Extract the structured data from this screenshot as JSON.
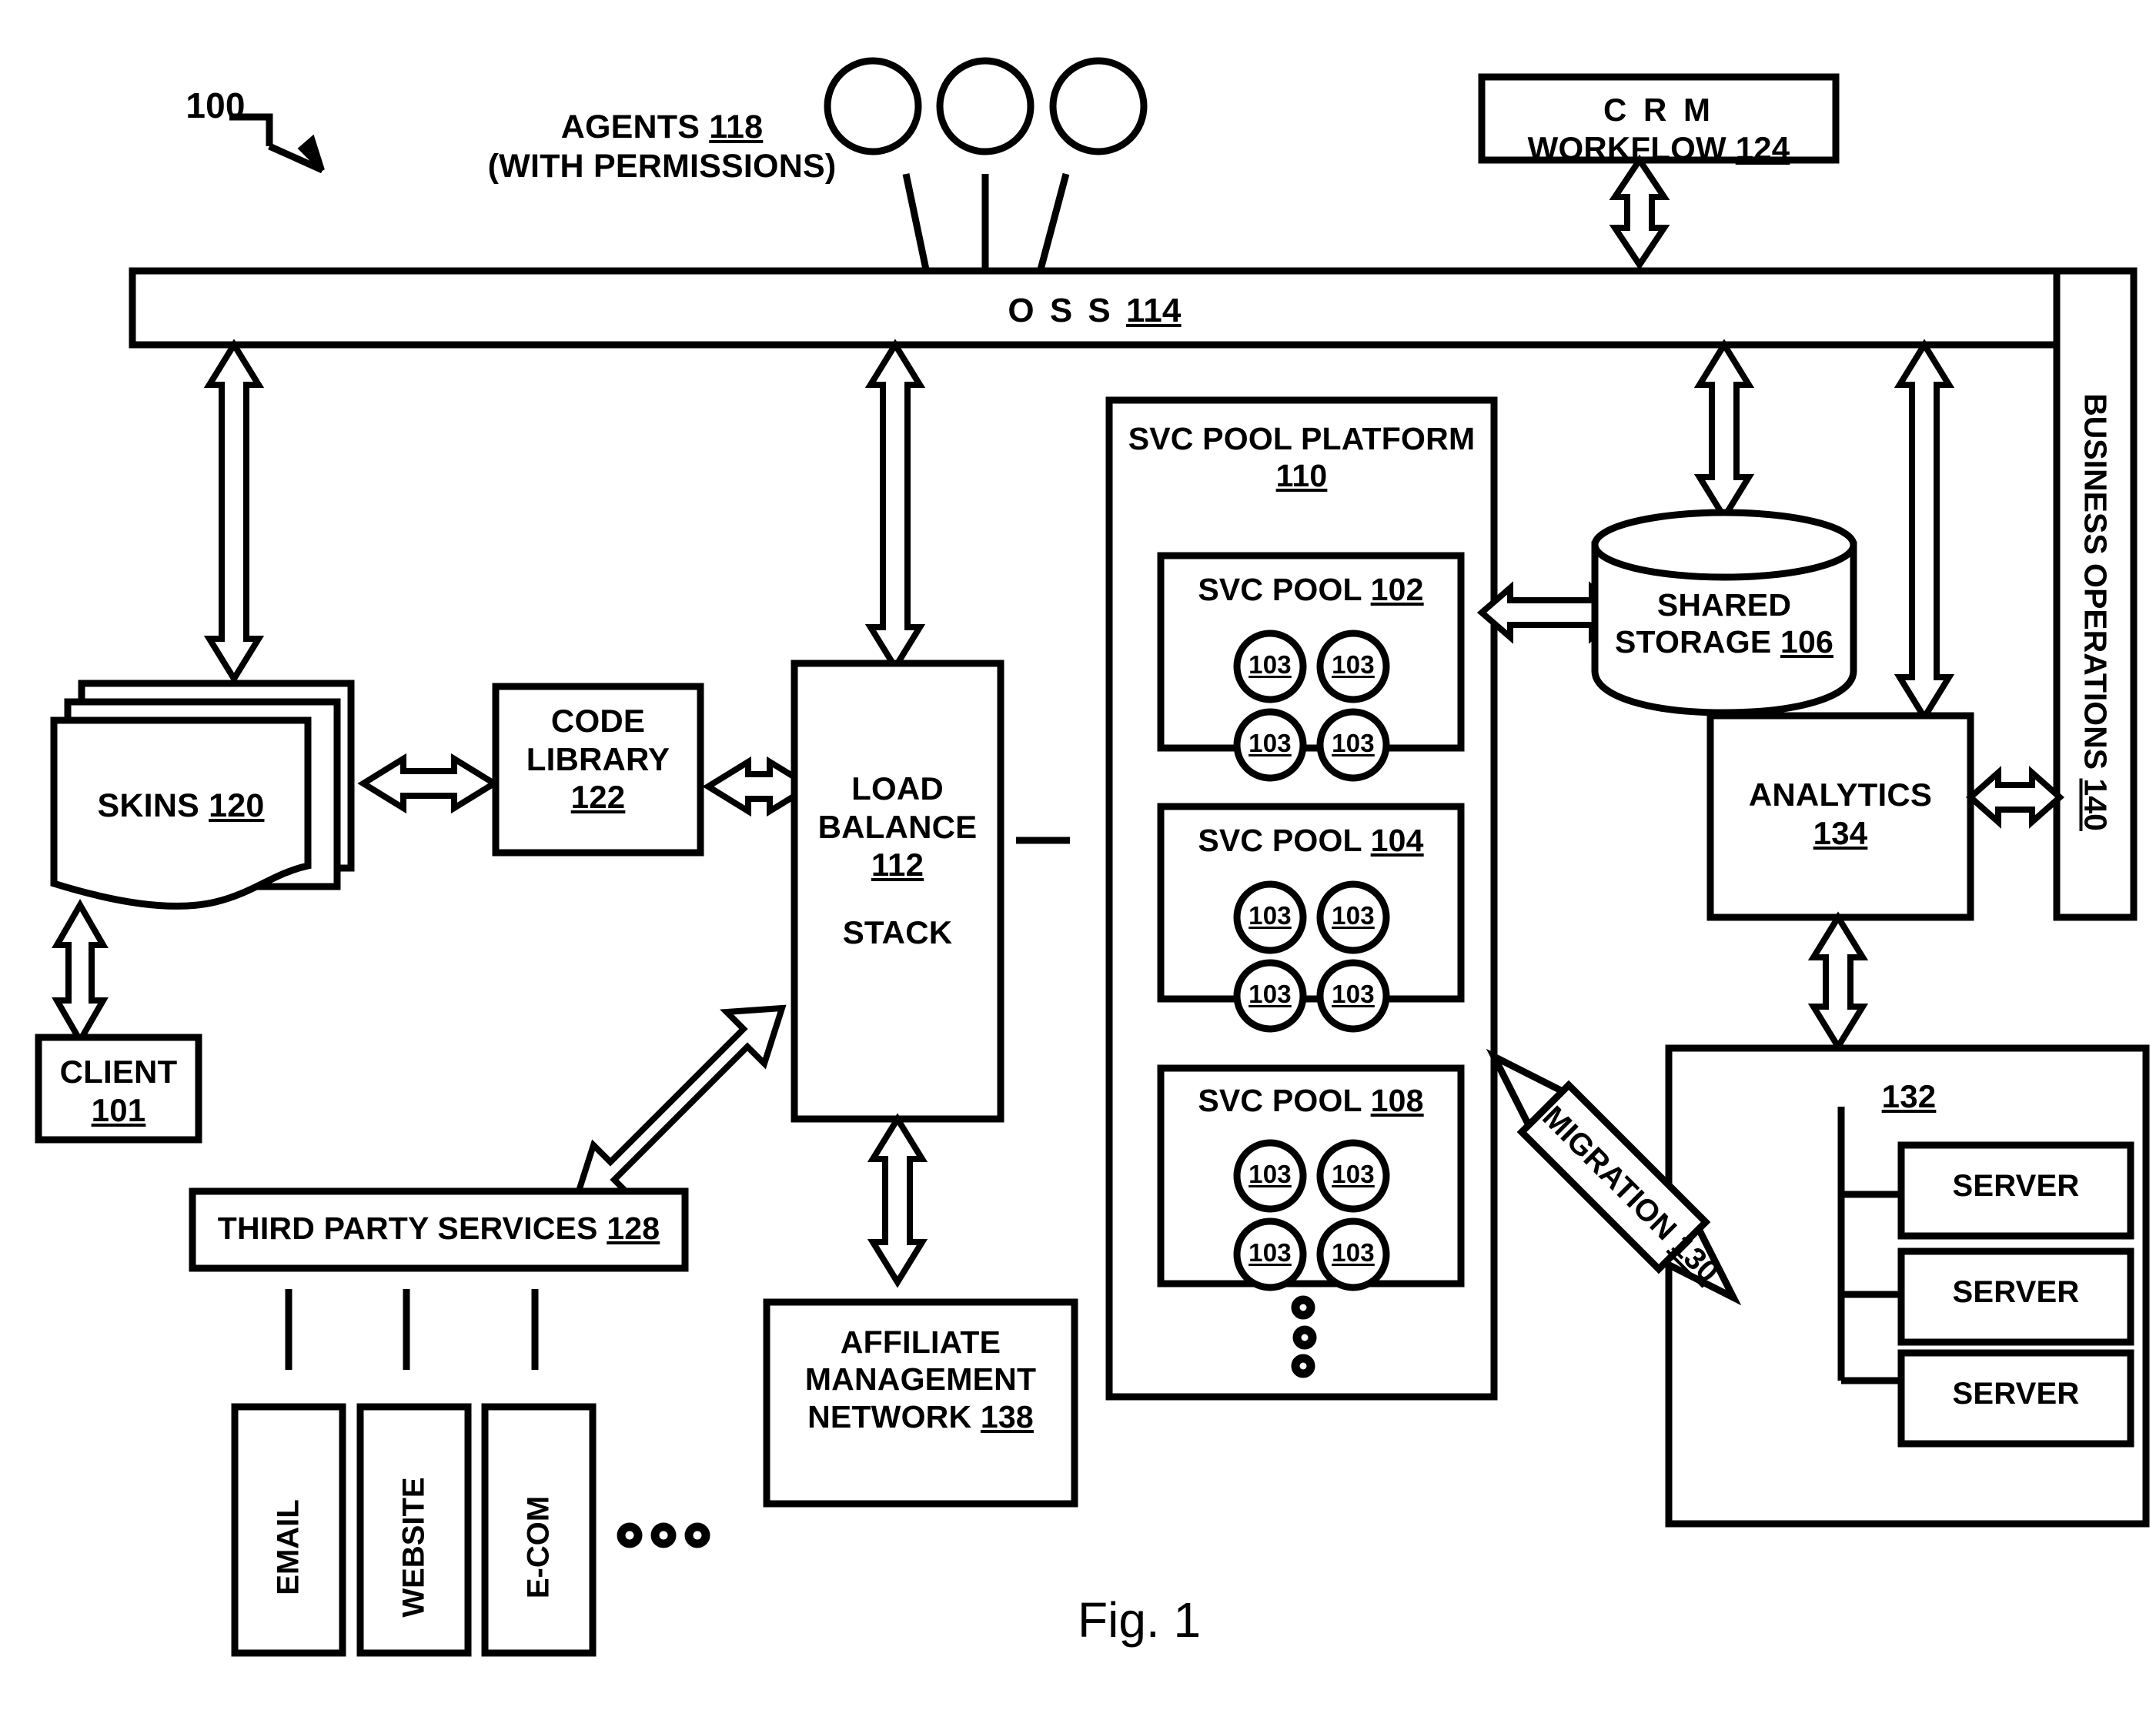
{
  "figure": {
    "caption": "Fig. 1",
    "system_ref": "100"
  },
  "nodes": {
    "agents": {
      "line1": "AGENTS ",
      "ref": "118",
      "line2": "(WITH PERMISSIONS)",
      "count": 3
    },
    "crm_workflow": {
      "line1": "C R M",
      "line2": "WORKFLOW ",
      "ref": "124"
    },
    "oss": {
      "label": "O S S ",
      "ref": "114"
    },
    "business_operations": {
      "label": "BUSINESS OPERATIONS ",
      "ref": "140"
    },
    "skins": {
      "label": "SKINS ",
      "ref": "120"
    },
    "client": {
      "label": "CLIENT",
      "ref": "101"
    },
    "code_library": {
      "line1": "CODE",
      "line2": "LIBRARY",
      "ref": "122"
    },
    "load_balance": {
      "line1": "LOAD",
      "line2": "BALANCE",
      "ref": "112",
      "line3": "STACK"
    },
    "svc_pool_platform": {
      "label": "SVC POOL PLATFORM",
      "ref": "110"
    },
    "svc_pools": [
      {
        "label": "SVC POOL ",
        "ref": "102",
        "nodes": [
          "103",
          "103",
          "103",
          "103"
        ]
      },
      {
        "label": "SVC POOL ",
        "ref": "104",
        "nodes": [
          "103",
          "103",
          "103",
          "103"
        ]
      },
      {
        "label": "SVC POOL ",
        "ref": "108",
        "nodes": [
          "103",
          "103",
          "103",
          "103"
        ]
      }
    ],
    "pool_ellipsis": "⋮",
    "shared_storage": {
      "line1": "SHARED",
      "line2": "STORAGE ",
      "ref": "106"
    },
    "analytics": {
      "label": "ANALYTICS",
      "ref": "134"
    },
    "migration": {
      "label": "MIGRATION ",
      "ref": "130"
    },
    "server_group": {
      "ref": "132",
      "servers": [
        "SERVER",
        "SERVER",
        "SERVER"
      ]
    },
    "third_party_services": {
      "label": "THIRD PARTY SERVICES ",
      "ref": "128"
    },
    "third_party_items": [
      "EMAIL",
      "WEBSITE",
      "E-COM"
    ],
    "third_party_ellipsis": "● ● ●",
    "affiliate_network": {
      "line1": "AFFILIATE",
      "line2": "MANAGEMENT",
      "line3": "NETWORK ",
      "ref": "138"
    }
  },
  "style": {
    "stroke": "#000000",
    "fill": "#ffffff"
  }
}
